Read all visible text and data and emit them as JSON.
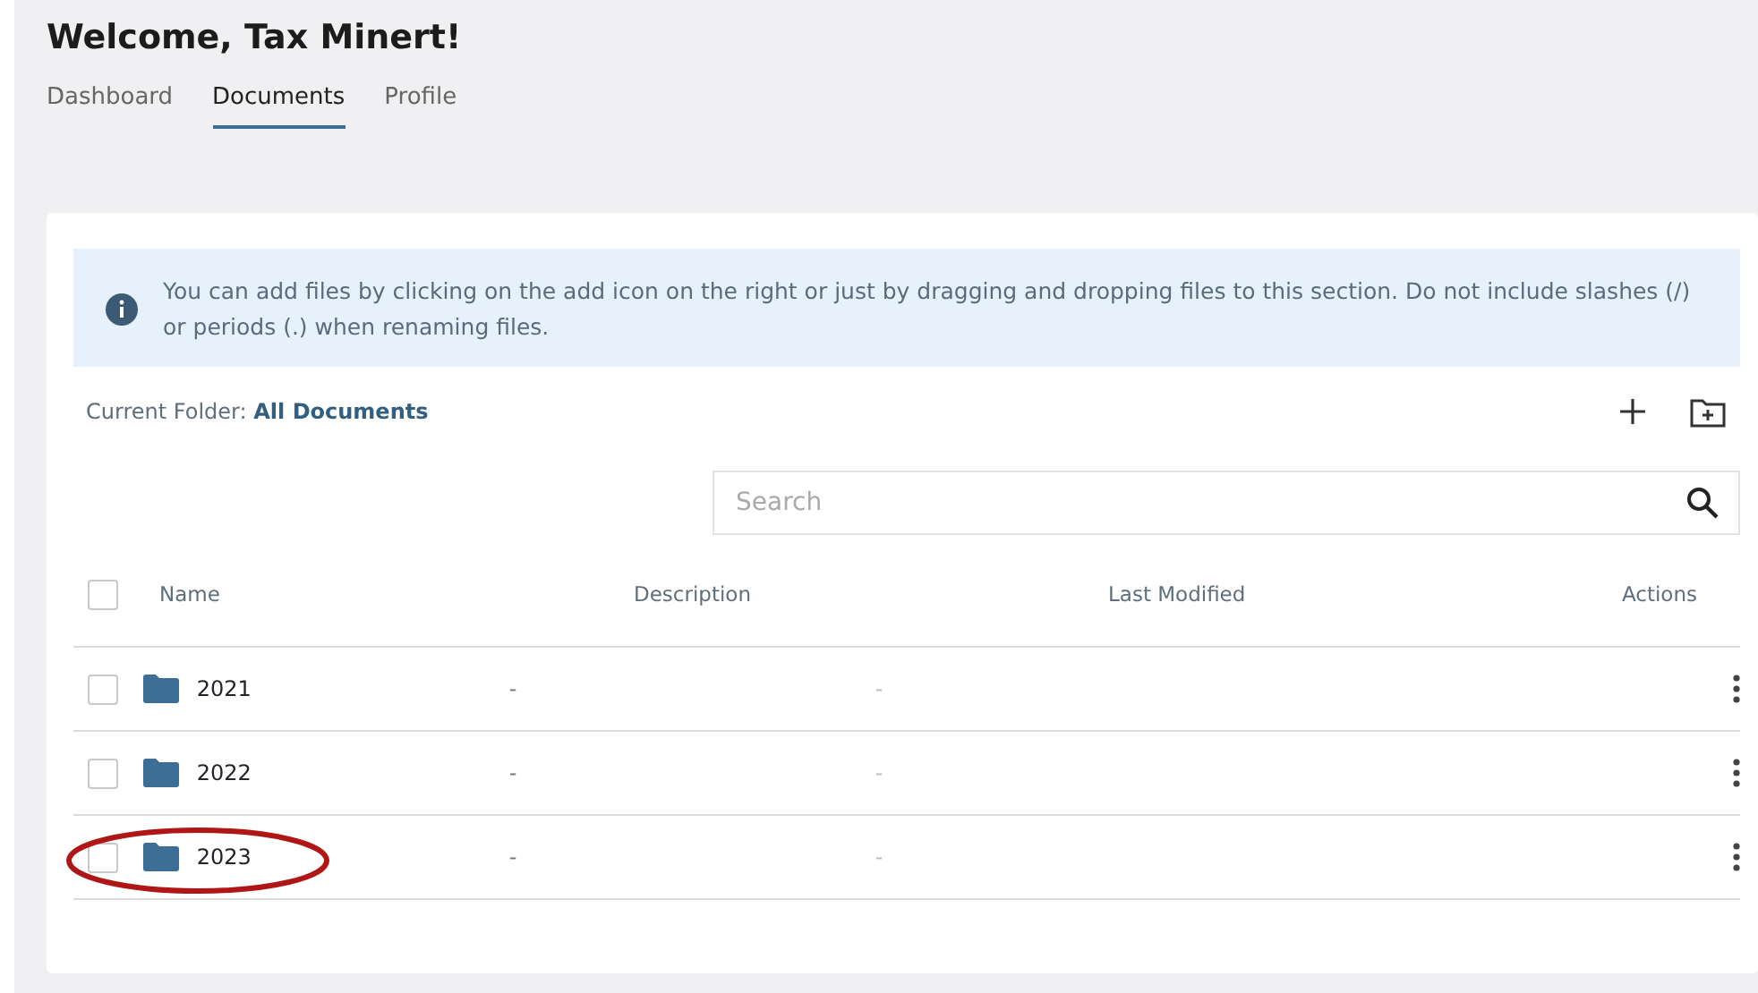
{
  "title": "Welcome, Tax Minert!",
  "tabs": [
    {
      "label": "Dashboard",
      "selected": false
    },
    {
      "label": "Documents",
      "selected": true
    },
    {
      "label": "Profile",
      "selected": false
    }
  ],
  "info_alert": "You can add files by clicking on the add icon on the right or just by dragging and dropping files to this section. Do not include slashes (/) or periods (.) when renaming files.",
  "current_folder": {
    "label": "Current Folder:",
    "value": "All Documents"
  },
  "search": {
    "placeholder": "Search"
  },
  "table": {
    "select_all_checked": false,
    "columns": [
      "Name",
      "Description",
      "Last Modified",
      "Actions"
    ],
    "rows": [
      {
        "name": "2021",
        "description": "-",
        "last_modified": "-",
        "checked": false,
        "circled": false
      },
      {
        "name": "2022",
        "description": "-",
        "last_modified": "-",
        "checked": false,
        "circled": false
      },
      {
        "name": "2023",
        "description": "-",
        "last_modified": "-",
        "checked": false,
        "circled": true
      }
    ]
  }
}
